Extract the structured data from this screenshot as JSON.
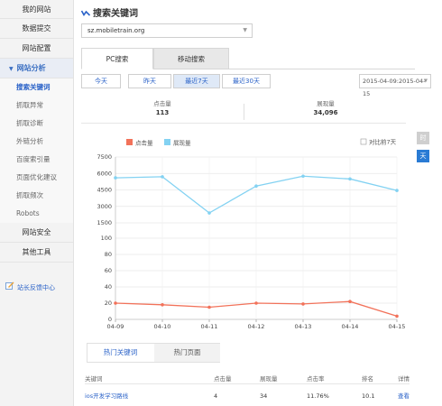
{
  "sidebar": {
    "items": [
      {
        "label": "我的网站"
      },
      {
        "label": "数据提交"
      },
      {
        "label": "网站配置"
      }
    ],
    "open_group": {
      "label": "网站分析",
      "arrow": "▼"
    },
    "sub_items": [
      {
        "label": "搜索关键词"
      },
      {
        "label": "抓取异常"
      },
      {
        "label": "抓取诊断"
      },
      {
        "label": "外链分析"
      },
      {
        "label": "百度索引量"
      },
      {
        "label": "页面优化建议"
      },
      {
        "label": "抓取频次"
      },
      {
        "label": "Robots"
      }
    ],
    "more_items": [
      {
        "label": "网站安全"
      },
      {
        "label": "其他工具"
      }
    ],
    "feedback": {
      "label": "站长反馈中心",
      "icon": "feedback-icon"
    }
  },
  "header": {
    "title": "搜索关键词",
    "icon": "zigzag-icon"
  },
  "site_select": {
    "value": "sz.mobiletrain.org"
  },
  "search_tabs": [
    {
      "label": "PC搜索"
    },
    {
      "label": "移动搜索"
    }
  ],
  "range": {
    "buttons": [
      {
        "label": "今天"
      },
      {
        "label": "昨天"
      },
      {
        "label": "最近7天"
      },
      {
        "label": "最近30天"
      }
    ],
    "selected": "最近7天",
    "date_value": "2015-04-09:2015-04-15"
  },
  "summary": {
    "clicks": {
      "label": "点击量",
      "value": "113"
    },
    "impressions": {
      "label": "展现量",
      "value": "34,096"
    }
  },
  "colors": {
    "clicks": "#f2725a",
    "impressions": "#83d2f2",
    "accent": "#2a62c8"
  },
  "chart_data": {
    "type": "line",
    "x": [
      "04-09",
      "04-10",
      "04-11",
      "04-12",
      "04-13",
      "04-14",
      "04-15"
    ],
    "series": [
      {
        "name": "点击量",
        "values": [
          20,
          18,
          15,
          20,
          19,
          22,
          4
        ]
      },
      {
        "name": "展现量",
        "values": [
          5600,
          5700,
          2400,
          4850,
          5750,
          5500,
          4450
        ]
      }
    ],
    "y_ticks_low": [
      0,
      20,
      40,
      60,
      80,
      100
    ],
    "y_ticks_high": [
      1500,
      3000,
      4500,
      6000,
      7500
    ],
    "ylim": [
      0,
      7500
    ],
    "grid": true,
    "legend": "top-left",
    "compare_label": "对比前7天",
    "compare_checked": false
  },
  "bottom_tabs": [
    {
      "label": "热门关键词"
    },
    {
      "label": "热门页面"
    }
  ],
  "table": {
    "columns": [
      "关键词",
      "点击量",
      "展现量",
      "点击率",
      "排名",
      "详情"
    ],
    "rows": [
      {
        "keyword": "ios开发学习路线",
        "clicks": "4",
        "impressions": "34",
        "ctr": "11.76%",
        "rank": "10.1",
        "detail": "查看"
      }
    ]
  },
  "side_tabs": [
    {
      "label": "时"
    },
    {
      "label": "天"
    }
  ]
}
